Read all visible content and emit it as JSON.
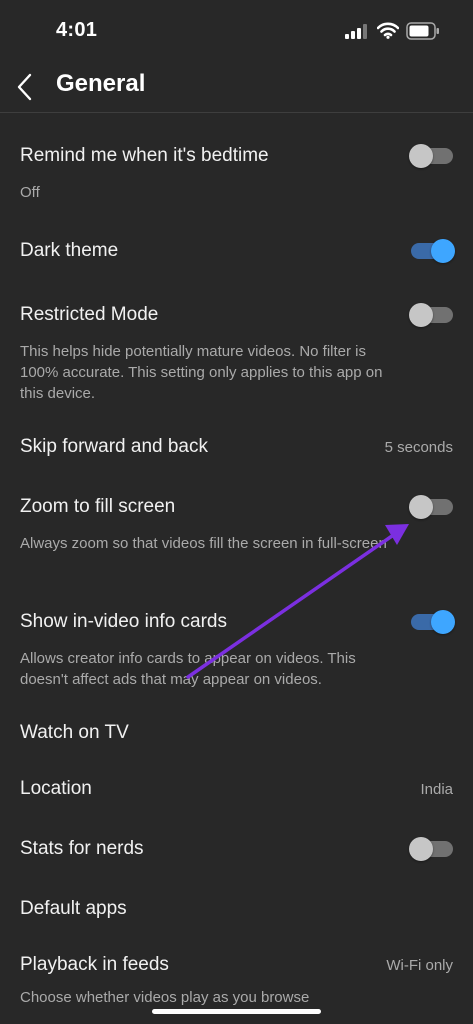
{
  "status": {
    "time": "4:01"
  },
  "header": {
    "title": "General"
  },
  "settings": [
    {
      "title": "Remind me when it's bedtime",
      "desc": "Off",
      "toggle": false
    },
    {
      "title": "Dark theme",
      "toggle": true
    },
    {
      "title": "Restricted Mode",
      "desc": "This helps hide potentially mature videos. No filter is 100% accurate. This setting only applies to this app on this device.",
      "toggle": false
    },
    {
      "title": "Skip forward and back",
      "value": "5 seconds"
    },
    {
      "title": "Zoom to fill screen",
      "desc": "Always zoom so that videos fill the screen in full-screen",
      "toggle": false
    },
    {
      "title": "Show in-video info cards",
      "desc": "Allows creator info cards to appear on videos. This doesn't affect ads that may appear on videos.",
      "toggle": true
    },
    {
      "title": "Watch on TV"
    },
    {
      "title": "Location",
      "value": "India"
    },
    {
      "title": "Stats for nerds",
      "toggle": false
    },
    {
      "title": "Default apps"
    },
    {
      "title": "Playback in feeds",
      "value": "Wi-Fi only",
      "desc": "Choose whether videos play as you browse"
    }
  ],
  "colors": {
    "background": "#282828",
    "accent": "#3ea6ff",
    "annotation_arrow": "#7b2fe0"
  }
}
